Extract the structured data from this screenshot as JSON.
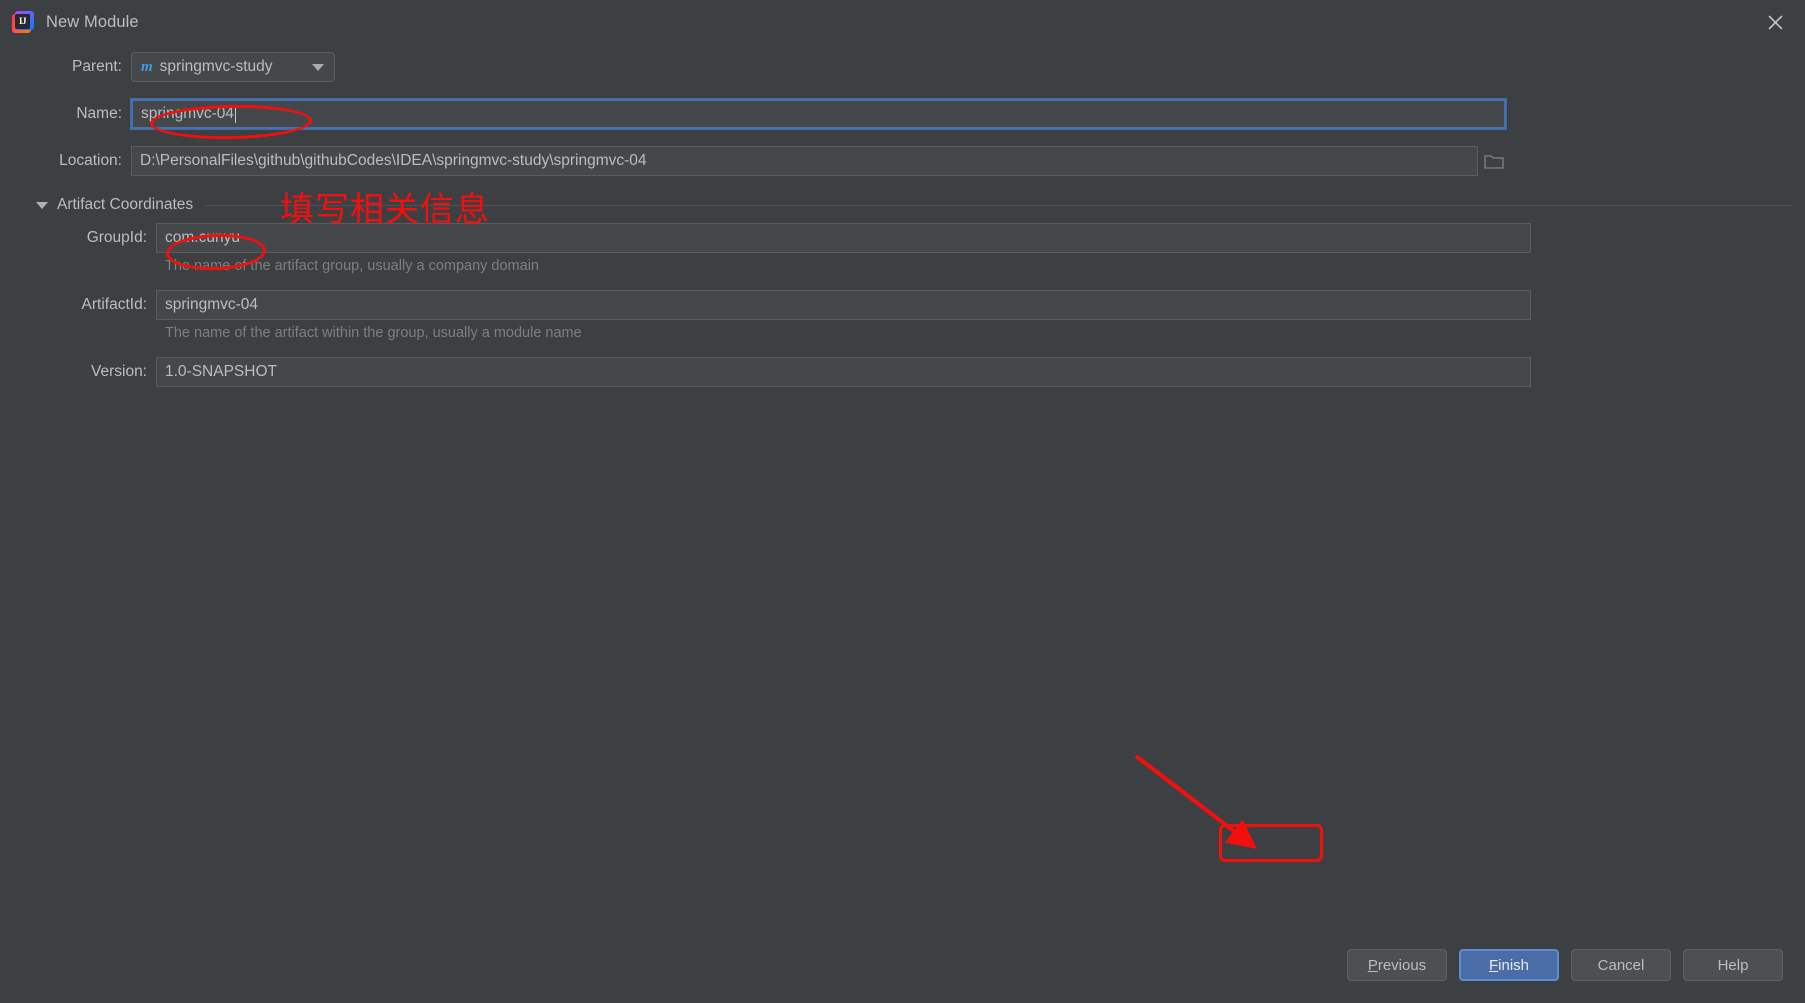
{
  "window": {
    "title": "New Module",
    "app_icon": "intellij-idea-icon",
    "icon_letters": "IJ",
    "close_icon": "close-icon"
  },
  "form": {
    "parent": {
      "label": "Parent:",
      "value": "springmvc-study",
      "module_icon_letter": "m",
      "module_icon_color": "#3d9ee0",
      "dropdown_icon": "chevron-down-icon"
    },
    "name": {
      "label": "Name:",
      "value": "springmvc-04",
      "focused": true
    },
    "location": {
      "label": "Location:",
      "value": "D:\\PersonalFiles\\github\\githubCodes\\IDEA\\springmvc-study\\springmvc-04",
      "browse_icon": "folder-icon"
    }
  },
  "artifact_section": {
    "title": "Artifact Coordinates",
    "expanded": true,
    "collapse_icon": "triangle-down-icon",
    "fields": [
      {
        "label": "GroupId:",
        "value": "com.cunyu",
        "hint": "The name of the artifact group, usually a company domain"
      },
      {
        "label": "ArtifactId:",
        "value": "springmvc-04",
        "hint": "The name of the artifact within the group, usually a module name"
      },
      {
        "label": "Version:",
        "value": "1.0-SNAPSHOT",
        "hint": ""
      }
    ]
  },
  "buttons": {
    "previous": {
      "label": "Previous",
      "mnemonic": "P"
    },
    "finish": {
      "label": "Finish",
      "mnemonic": "F",
      "primary": true
    },
    "cancel": {
      "label": "Cancel"
    },
    "help": {
      "label": "Help"
    }
  },
  "annotations": {
    "chinese_note": "填写相关信息",
    "color": "#f40f0f",
    "ellipse_name": "red-ellipse-around-name-value",
    "ellipse_groupid": "red-ellipse-around-groupid-value",
    "ellipse_finish": "red-rounded-box-around-finish-button",
    "arrow": "red-arrow-pointing-to-finish-button"
  },
  "theme": {
    "background": "#3c4043",
    "field_background": "#45484a",
    "text": "#bcbcbc",
    "hint_text": "#7c7f80",
    "focus_border": "#4b6eaf",
    "primary_button": "#4a6da7"
  }
}
